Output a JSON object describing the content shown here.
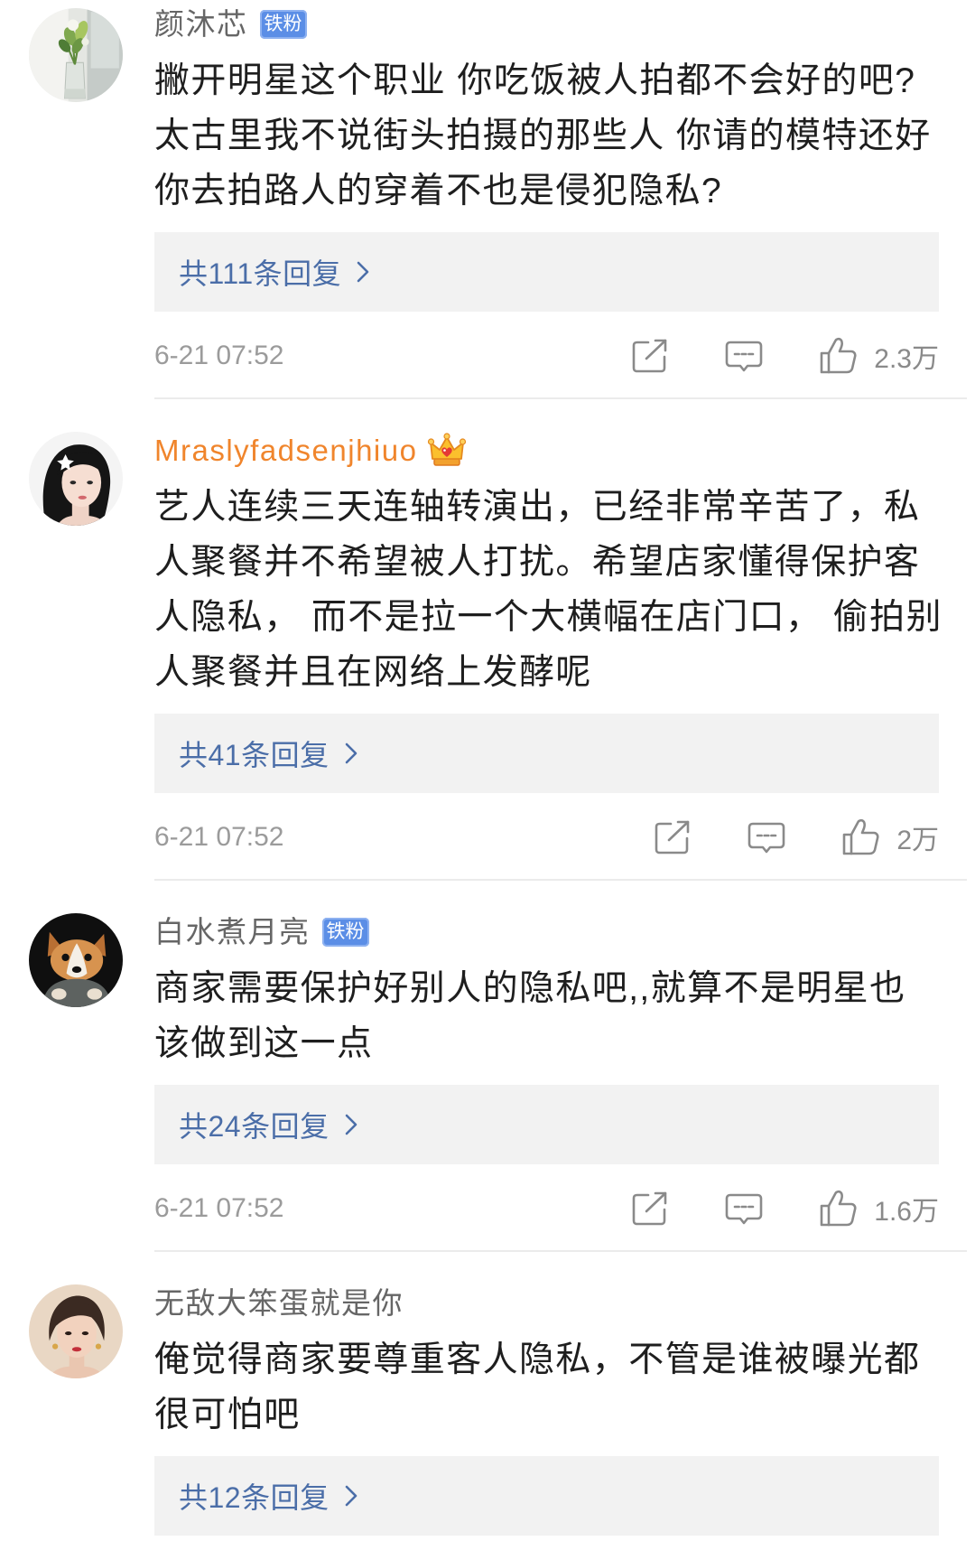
{
  "comments": [
    {
      "username": "颜沐芯",
      "badge": "铁粉",
      "lines": [
        "撇开明星这个职业 你吃饭被人拍都不会好的吧?",
        "太古里我不说街头拍摄的那些人 你请的模特还好",
        "你去拍路人的穿着不也是侵犯隐私?"
      ],
      "replies": "共111条回复",
      "time": "6-21 07:52",
      "likes": "2.3万"
    },
    {
      "username": "Mraslyfadsenjhiuo",
      "username_color": "#f0852c",
      "vip_icon": "crown-icon",
      "lines": [
        "艺人连续三天连轴转演出，已经非常辛苦了，私",
        "人聚餐并不希望被人打扰。希望店家懂得保护客",
        "人隐私， 而不是拉一个大横幅在店门口， 偷拍别",
        "人聚餐并且在网络上发酵呢"
      ],
      "replies": "共41条回复",
      "time": "6-21 07:52",
      "likes": "2万"
    },
    {
      "username": "白水煮月亮",
      "badge": "铁粉",
      "lines": [
        "商家需要保护好别人的隐私吧,,就算不是明星也",
        "该做到这一点"
      ],
      "replies": "共24条回复",
      "time": "6-21 07:52",
      "likes": "1.6万"
    },
    {
      "username": "无敌大笨蛋就是你",
      "lines": [
        "俺觉得商家要尊重客人隐私，不管是谁被曝光都",
        "很可怕吧"
      ],
      "replies": "共12条回复"
    }
  ],
  "icons": {
    "share": "share-icon",
    "comment": "comment-icon",
    "like": "like-icon",
    "replies_arrow": "chevron-right-icon",
    "vip": "crown-icon"
  },
  "colors": {
    "username": "#666666",
    "vip_username": "#f0852c",
    "badge_bg": "#5b8ee6",
    "body_text": "#1e1e1e",
    "reply_link": "#4b6ea8",
    "reply_box_bg": "#f2f2f2",
    "meta_text": "#9b9b9b",
    "divider": "#ebebeb"
  }
}
